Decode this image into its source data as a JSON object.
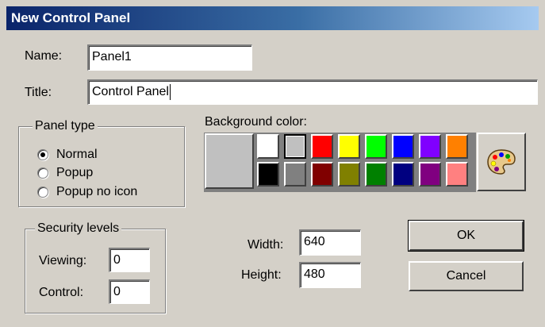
{
  "window": {
    "title": "New Control Panel"
  },
  "name": {
    "label": "Name:",
    "value": "Panel1"
  },
  "title_field": {
    "label": "Title:",
    "value": "Control Panel"
  },
  "panel_type": {
    "legend": "Panel type",
    "options": [
      {
        "label": "Normal",
        "checked": true
      },
      {
        "label": "Popup",
        "checked": false
      },
      {
        "label": "Popup no icon",
        "checked": false
      }
    ]
  },
  "security": {
    "legend": "Security levels",
    "viewing_label": "Viewing:",
    "viewing_value": "0",
    "control_label": "Control:",
    "control_value": "0"
  },
  "background": {
    "label": "Background color:",
    "current_color": "#c0c0c0",
    "palette_top": [
      "#ffffff",
      "#c0c0c0",
      "#ff0000",
      "#ffff00",
      "#00ff00",
      "#0000ff",
      "#8000ff",
      "#ff8000"
    ],
    "palette_bottom": [
      "#000000",
      "#808080",
      "#800000",
      "#808000",
      "#008000",
      "#000080",
      "#800080",
      "#ff8080"
    ],
    "selected_swatch": "#c0c0c0",
    "palette_button_icon": "palette-icon"
  },
  "size": {
    "width_label": "Width:",
    "width_value": "640",
    "height_label": "Height:",
    "height_value": "480"
  },
  "buttons": {
    "ok": "OK",
    "cancel": "Cancel"
  }
}
